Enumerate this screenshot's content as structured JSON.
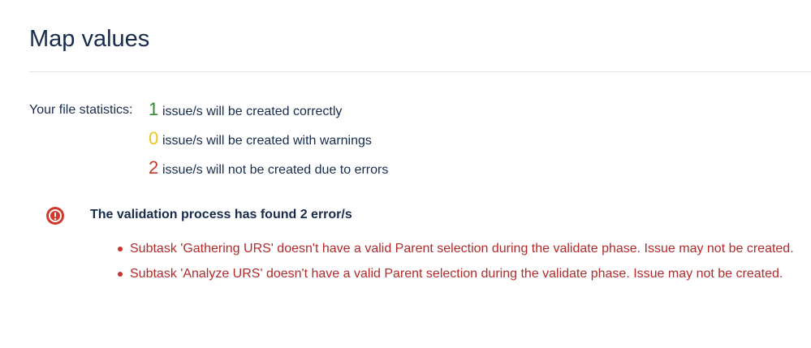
{
  "page": {
    "title": "Map values"
  },
  "stats": {
    "label": "Your file statistics:",
    "lines": [
      {
        "count": "1",
        "text": "issue/s will be created correctly",
        "color": "#2e8b2e"
      },
      {
        "count": "0",
        "text": "issue/s will be created with warnings",
        "color": "#e8c51a"
      },
      {
        "count": "2",
        "text": "issue/s will not be created due to errors",
        "color": "#c7352c"
      }
    ]
  },
  "validation": {
    "icon": "error-icon",
    "icon_color": "#d0392b",
    "title": "The validation process has found 2 error/s",
    "errors": [
      "Subtask 'Gathering URS' doesn't have a valid Parent selection during the validate phase. Issue may not be created.",
      "Subtask 'Analyze URS' doesn't have a valid Parent selection during the validate phase. Issue may not be created."
    ]
  }
}
